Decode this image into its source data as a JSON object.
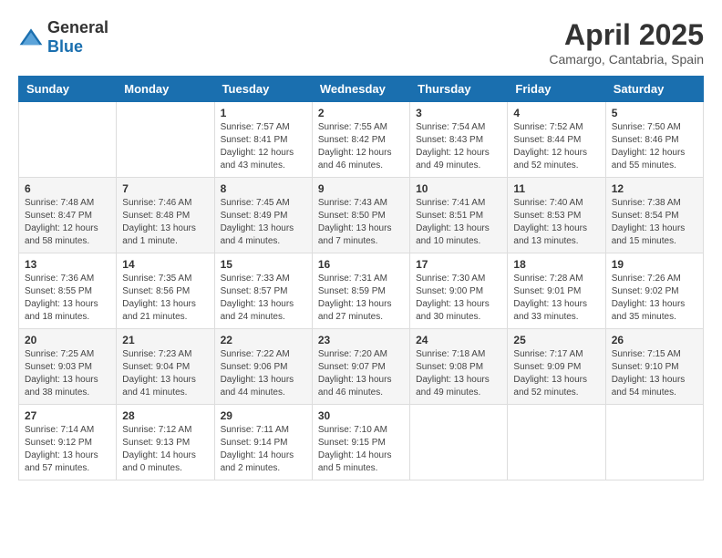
{
  "header": {
    "logo_general": "General",
    "logo_blue": "Blue",
    "month_year": "April 2025",
    "location": "Camargo, Cantabria, Spain"
  },
  "days_of_week": [
    "Sunday",
    "Monday",
    "Tuesday",
    "Wednesday",
    "Thursday",
    "Friday",
    "Saturday"
  ],
  "weeks": [
    [
      {
        "day": "",
        "info": ""
      },
      {
        "day": "",
        "info": ""
      },
      {
        "day": "1",
        "info": "Sunrise: 7:57 AM\nSunset: 8:41 PM\nDaylight: 12 hours\nand 43 minutes."
      },
      {
        "day": "2",
        "info": "Sunrise: 7:55 AM\nSunset: 8:42 PM\nDaylight: 12 hours\nand 46 minutes."
      },
      {
        "day": "3",
        "info": "Sunrise: 7:54 AM\nSunset: 8:43 PM\nDaylight: 12 hours\nand 49 minutes."
      },
      {
        "day": "4",
        "info": "Sunrise: 7:52 AM\nSunset: 8:44 PM\nDaylight: 12 hours\nand 52 minutes."
      },
      {
        "day": "5",
        "info": "Sunrise: 7:50 AM\nSunset: 8:46 PM\nDaylight: 12 hours\nand 55 minutes."
      }
    ],
    [
      {
        "day": "6",
        "info": "Sunrise: 7:48 AM\nSunset: 8:47 PM\nDaylight: 12 hours\nand 58 minutes."
      },
      {
        "day": "7",
        "info": "Sunrise: 7:46 AM\nSunset: 8:48 PM\nDaylight: 13 hours\nand 1 minute."
      },
      {
        "day": "8",
        "info": "Sunrise: 7:45 AM\nSunset: 8:49 PM\nDaylight: 13 hours\nand 4 minutes."
      },
      {
        "day": "9",
        "info": "Sunrise: 7:43 AM\nSunset: 8:50 PM\nDaylight: 13 hours\nand 7 minutes."
      },
      {
        "day": "10",
        "info": "Sunrise: 7:41 AM\nSunset: 8:51 PM\nDaylight: 13 hours\nand 10 minutes."
      },
      {
        "day": "11",
        "info": "Sunrise: 7:40 AM\nSunset: 8:53 PM\nDaylight: 13 hours\nand 13 minutes."
      },
      {
        "day": "12",
        "info": "Sunrise: 7:38 AM\nSunset: 8:54 PM\nDaylight: 13 hours\nand 15 minutes."
      }
    ],
    [
      {
        "day": "13",
        "info": "Sunrise: 7:36 AM\nSunset: 8:55 PM\nDaylight: 13 hours\nand 18 minutes."
      },
      {
        "day": "14",
        "info": "Sunrise: 7:35 AM\nSunset: 8:56 PM\nDaylight: 13 hours\nand 21 minutes."
      },
      {
        "day": "15",
        "info": "Sunrise: 7:33 AM\nSunset: 8:57 PM\nDaylight: 13 hours\nand 24 minutes."
      },
      {
        "day": "16",
        "info": "Sunrise: 7:31 AM\nSunset: 8:59 PM\nDaylight: 13 hours\nand 27 minutes."
      },
      {
        "day": "17",
        "info": "Sunrise: 7:30 AM\nSunset: 9:00 PM\nDaylight: 13 hours\nand 30 minutes."
      },
      {
        "day": "18",
        "info": "Sunrise: 7:28 AM\nSunset: 9:01 PM\nDaylight: 13 hours\nand 33 minutes."
      },
      {
        "day": "19",
        "info": "Sunrise: 7:26 AM\nSunset: 9:02 PM\nDaylight: 13 hours\nand 35 minutes."
      }
    ],
    [
      {
        "day": "20",
        "info": "Sunrise: 7:25 AM\nSunset: 9:03 PM\nDaylight: 13 hours\nand 38 minutes."
      },
      {
        "day": "21",
        "info": "Sunrise: 7:23 AM\nSunset: 9:04 PM\nDaylight: 13 hours\nand 41 minutes."
      },
      {
        "day": "22",
        "info": "Sunrise: 7:22 AM\nSunset: 9:06 PM\nDaylight: 13 hours\nand 44 minutes."
      },
      {
        "day": "23",
        "info": "Sunrise: 7:20 AM\nSunset: 9:07 PM\nDaylight: 13 hours\nand 46 minutes."
      },
      {
        "day": "24",
        "info": "Sunrise: 7:18 AM\nSunset: 9:08 PM\nDaylight: 13 hours\nand 49 minutes."
      },
      {
        "day": "25",
        "info": "Sunrise: 7:17 AM\nSunset: 9:09 PM\nDaylight: 13 hours\nand 52 minutes."
      },
      {
        "day": "26",
        "info": "Sunrise: 7:15 AM\nSunset: 9:10 PM\nDaylight: 13 hours\nand 54 minutes."
      }
    ],
    [
      {
        "day": "27",
        "info": "Sunrise: 7:14 AM\nSunset: 9:12 PM\nDaylight: 13 hours\nand 57 minutes."
      },
      {
        "day": "28",
        "info": "Sunrise: 7:12 AM\nSunset: 9:13 PM\nDaylight: 14 hours\nand 0 minutes."
      },
      {
        "day": "29",
        "info": "Sunrise: 7:11 AM\nSunset: 9:14 PM\nDaylight: 14 hours\nand 2 minutes."
      },
      {
        "day": "30",
        "info": "Sunrise: 7:10 AM\nSunset: 9:15 PM\nDaylight: 14 hours\nand 5 minutes."
      },
      {
        "day": "",
        "info": ""
      },
      {
        "day": "",
        "info": ""
      },
      {
        "day": "",
        "info": ""
      }
    ]
  ]
}
